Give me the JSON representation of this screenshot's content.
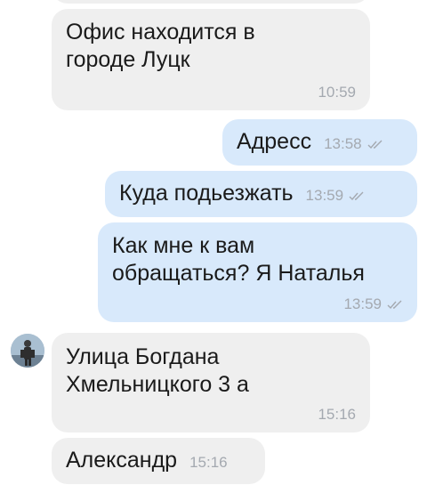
{
  "messages": [
    {
      "text": "Офис находится в\nгороде Луцк",
      "time": "10:59"
    },
    {
      "text": "Адресс",
      "time": "13:58"
    },
    {
      "text": "Куда подьезжать",
      "time": "13:59"
    },
    {
      "text": "Как мне к вам\nобращаться? Я Наталья",
      "time": "13:59"
    },
    {
      "text": "Улица Богдана\nХмельницкого 3 а",
      "time": "15:16"
    },
    {
      "text": "Александр",
      "time": "15:16"
    }
  ],
  "colors": {
    "incoming_bubble": "#efefef",
    "outgoing_bubble": "#d8e9fb",
    "time": "#a4a9b0"
  },
  "icons": {
    "read_status": "double-check-icon",
    "avatar": "contact-avatar"
  }
}
